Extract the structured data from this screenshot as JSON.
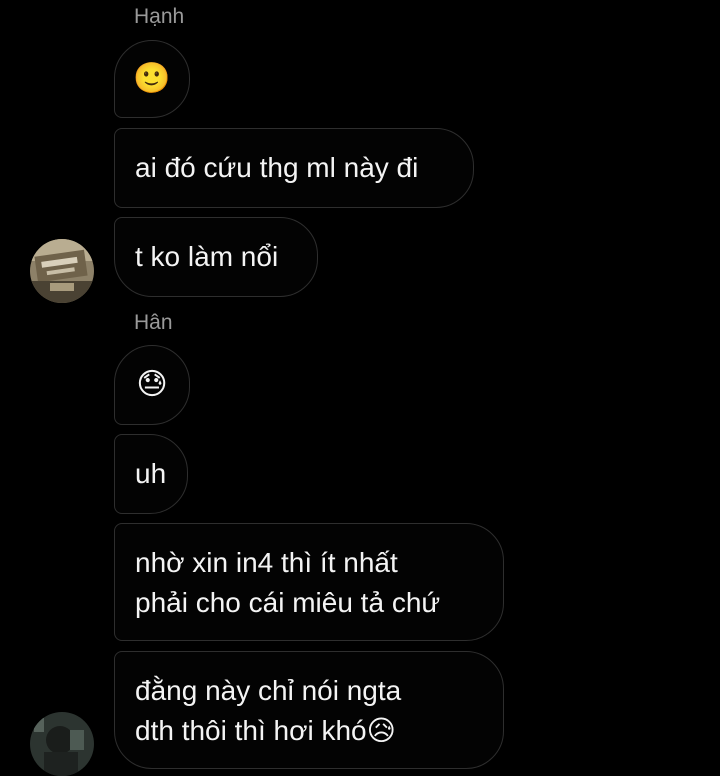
{
  "conversation": {
    "groups": [
      {
        "sender": "Hạnh",
        "messages": [
          {
            "text": "🙂"
          },
          {
            "text": "ai đó cứu thg ml này đi"
          },
          {
            "text": "t ko làm nổi"
          }
        ],
        "avatar_icon": "user-avatar-photo"
      },
      {
        "sender": "Hân",
        "messages": [
          {
            "text": "😓"
          },
          {
            "text": "uh"
          },
          {
            "lines": [
              "nhờ xin in4 thì ít nhất",
              "phải cho cái miêu tả chứ"
            ]
          },
          {
            "lines": [
              "đằng này chỉ nói ngta",
              "dth thôi thì hơi khó"
            ],
            "trailing_emoji": "😥"
          }
        ],
        "avatar_icon": "user-avatar-photo"
      }
    ]
  },
  "colors": {
    "background": "#000000",
    "bubble_border": "#2e2e2e",
    "text": "#f4f4f4",
    "sender_name": "#9a9a9a"
  }
}
